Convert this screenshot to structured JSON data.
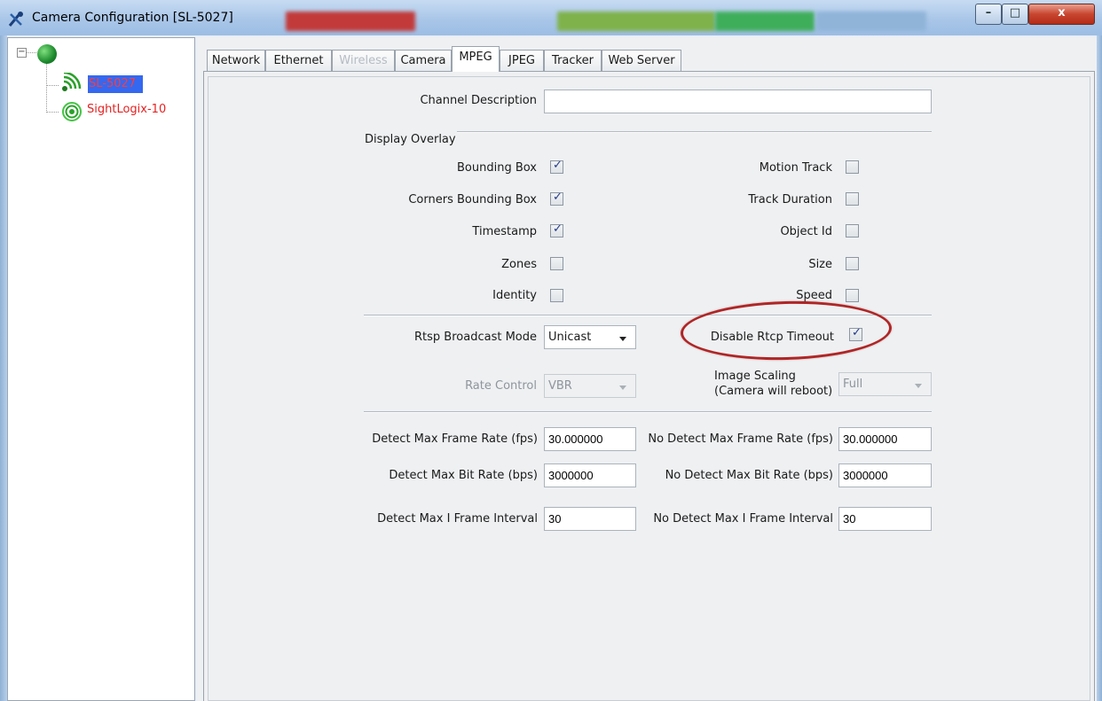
{
  "window": {
    "title": "Camera Configuration [SL-5027]",
    "app_icon": "tools-icon",
    "controls": {
      "minimize": "–",
      "maximize": "□",
      "close": "x"
    }
  },
  "tree": {
    "nodes": [
      {
        "label": "SL-5027",
        "icon": "camera-signal-icon",
        "selected": true,
        "color": "#ff3b3b"
      },
      {
        "label": "SightLogix-10",
        "icon": "camera-broadcast-icon",
        "selected": false,
        "color": "#e52222"
      }
    ]
  },
  "tabs": [
    {
      "label": "Network",
      "active": false,
      "enabled": true
    },
    {
      "label": "Ethernet",
      "active": false,
      "enabled": true
    },
    {
      "label": "Wireless",
      "active": false,
      "enabled": false
    },
    {
      "label": "Camera",
      "active": false,
      "enabled": true
    },
    {
      "label": "MPEG",
      "active": true,
      "enabled": true
    },
    {
      "label": "JPEG",
      "active": false,
      "enabled": true
    },
    {
      "label": "Tracker",
      "active": false,
      "enabled": true
    },
    {
      "label": "Web Server",
      "active": false,
      "enabled": true
    }
  ],
  "mpeg": {
    "channel_description": {
      "label": "Channel Description",
      "value": ""
    },
    "display_overlay": {
      "heading": "Display Overlay",
      "left": [
        {
          "label": "Bounding Box",
          "checked": true
        },
        {
          "label": "Corners Bounding Box",
          "checked": true
        },
        {
          "label": "Timestamp",
          "checked": true
        },
        {
          "label": "Zones",
          "checked": false
        },
        {
          "label": "Identity",
          "checked": false
        }
      ],
      "right": [
        {
          "label": "Motion Track",
          "checked": false
        },
        {
          "label": "Track Duration",
          "checked": false
        },
        {
          "label": "Object Id",
          "checked": false
        },
        {
          "label": "Size",
          "checked": false
        },
        {
          "label": "Speed",
          "checked": false
        }
      ]
    },
    "rtsp_broadcast_mode": {
      "label": "Rtsp Broadcast Mode",
      "value": "Unicast"
    },
    "disable_rtcp_timeout": {
      "label": "Disable Rtcp Timeout",
      "checked": true
    },
    "rate_control": {
      "label": "Rate Control",
      "value": "VBR",
      "enabled": false
    },
    "image_scaling": {
      "label_line1": "Image Scaling",
      "label_line2": "(Camera will reboot)",
      "value": "Full",
      "enabled": false
    },
    "rates": {
      "detect_max_frame_rate": {
        "label": "Detect Max Frame Rate (fps)",
        "value": "30.000000"
      },
      "no_detect_max_frame_rate": {
        "label": "No Detect Max Frame Rate (fps)",
        "value": "30.000000"
      },
      "detect_max_bit_rate": {
        "label": "Detect Max Bit Rate (bps)",
        "value": "3000000"
      },
      "no_detect_max_bit_rate": {
        "label": "No Detect Max Bit Rate (bps)",
        "value": "3000000"
      },
      "detect_max_i_frame_interval": {
        "label": "Detect Max I Frame Interval",
        "value": "30"
      },
      "no_detect_max_i_frame_interval": {
        "label": "No Detect Max I Frame Interval",
        "value": "30"
      }
    }
  },
  "colors": {
    "selection": "#3468f0",
    "annotation_oval": "#b02525",
    "check_mark": "#223a8a"
  }
}
